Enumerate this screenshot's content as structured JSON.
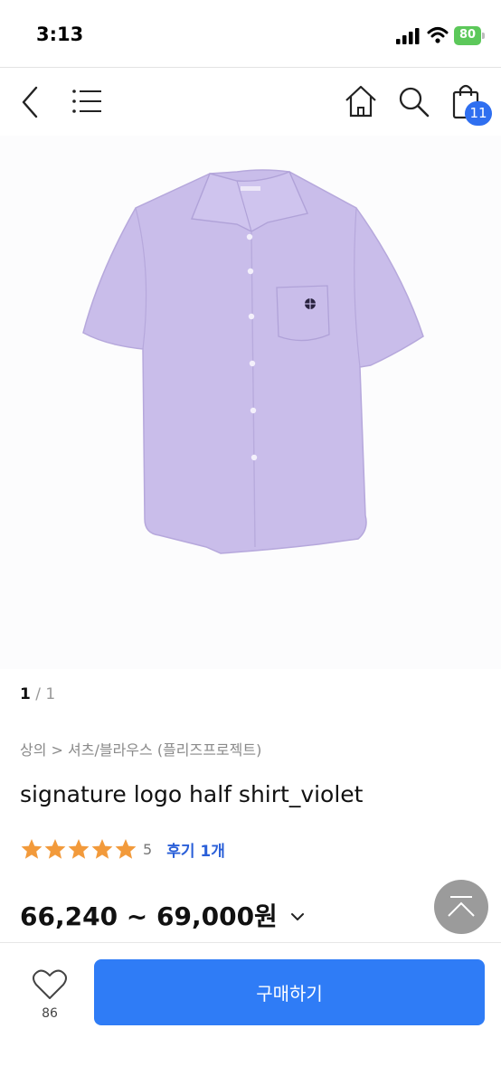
{
  "status_bar": {
    "time": "3:13",
    "battery": "80",
    "battery_color": "#5cc85a"
  },
  "nav": {
    "icons": [
      "back-icon",
      "menu-icon",
      "home-icon",
      "search-icon",
      "shopping-bag-icon"
    ],
    "cart_count": "11",
    "badge_color": "#2f6ff0"
  },
  "product": {
    "image_color": "#c9bdea",
    "image_counter": {
      "current": "1",
      "total": " / 1"
    },
    "breadcrumb": "상의 > 셔츠/블라우스 (플리즈프로젝트)",
    "title": "signature logo half shirt_violet",
    "rating": {
      "stars": 5,
      "score": "5",
      "review_label": "후기 1개",
      "star_color": "#f29a3b"
    },
    "price": "66,240 ~ 69,000원"
  },
  "bottom_bar": {
    "like_count": "86",
    "buy_label": "구매하기",
    "buy_color": "#2f7cf6"
  }
}
